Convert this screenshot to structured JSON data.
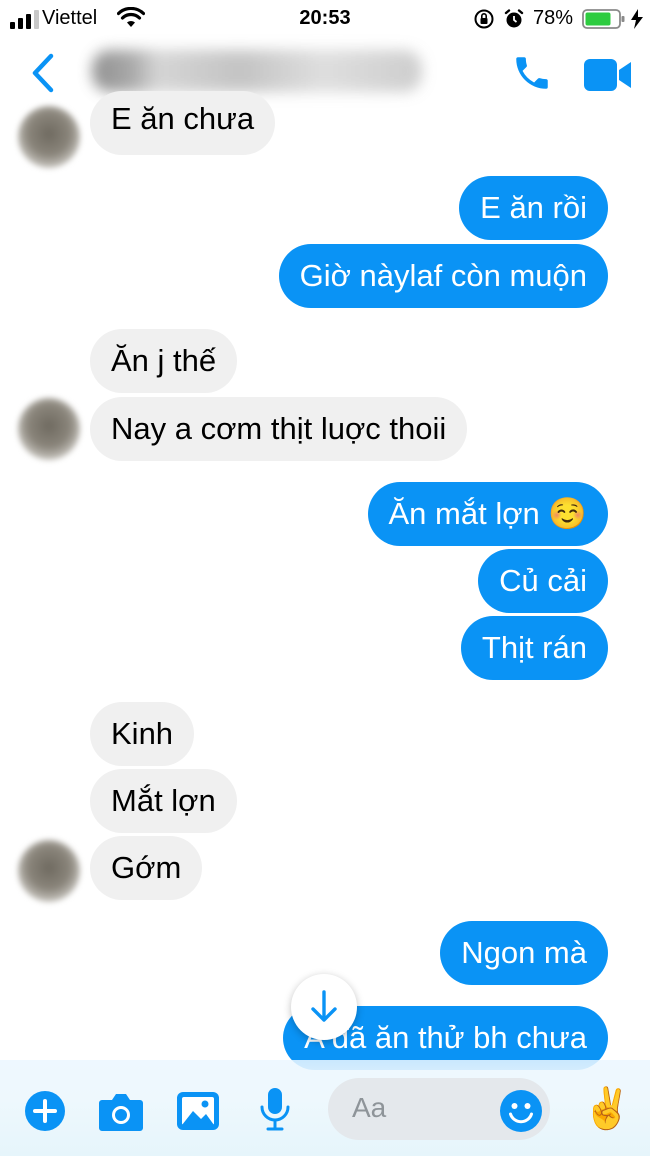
{
  "status_bar": {
    "carrier": "Viettel",
    "time": "20:53",
    "battery_percent": "78%",
    "signal_bars_filled": 3,
    "battery_level": 0.78
  },
  "nav": {
    "back_icon": "chevron-left-icon",
    "call_icon": "phone-icon",
    "video_icon": "video-camera-icon",
    "accent": "#0a93f5"
  },
  "messages": [
    {
      "side": "in",
      "text": "E ăn chưa"
    },
    {
      "side": "out",
      "text": "E ăn rồi"
    },
    {
      "side": "out",
      "text": "Giờ nàylaf còn muộn"
    },
    {
      "side": "in",
      "text": "Ăn j thế"
    },
    {
      "side": "in",
      "text": "Nay a cơm thịt luợc thoii"
    },
    {
      "side": "out",
      "text": "Ăn mắt lợn ☺️"
    },
    {
      "side": "out",
      "text": "Củ cải"
    },
    {
      "side": "out",
      "text": "Thịt rán"
    },
    {
      "side": "in",
      "text": "Kinh"
    },
    {
      "side": "in",
      "text": "Mắt lợn"
    },
    {
      "side": "in",
      "text": "Gớm"
    },
    {
      "side": "out",
      "text": "Ngon mà"
    },
    {
      "side": "out",
      "text": "A đã ăn thử bh chưa"
    }
  ],
  "composer": {
    "placeholder": "Aa",
    "icons": [
      "plus-icon",
      "camera-icon",
      "image-icon",
      "microphone-icon",
      "emoji-icon",
      "victory-hand-icon"
    ],
    "quick_reaction": "✌️"
  },
  "colors": {
    "outgoing_bubble": "#0a93f5",
    "incoming_bubble": "#f0f0f0",
    "icon_blue": "#0a93f5"
  }
}
